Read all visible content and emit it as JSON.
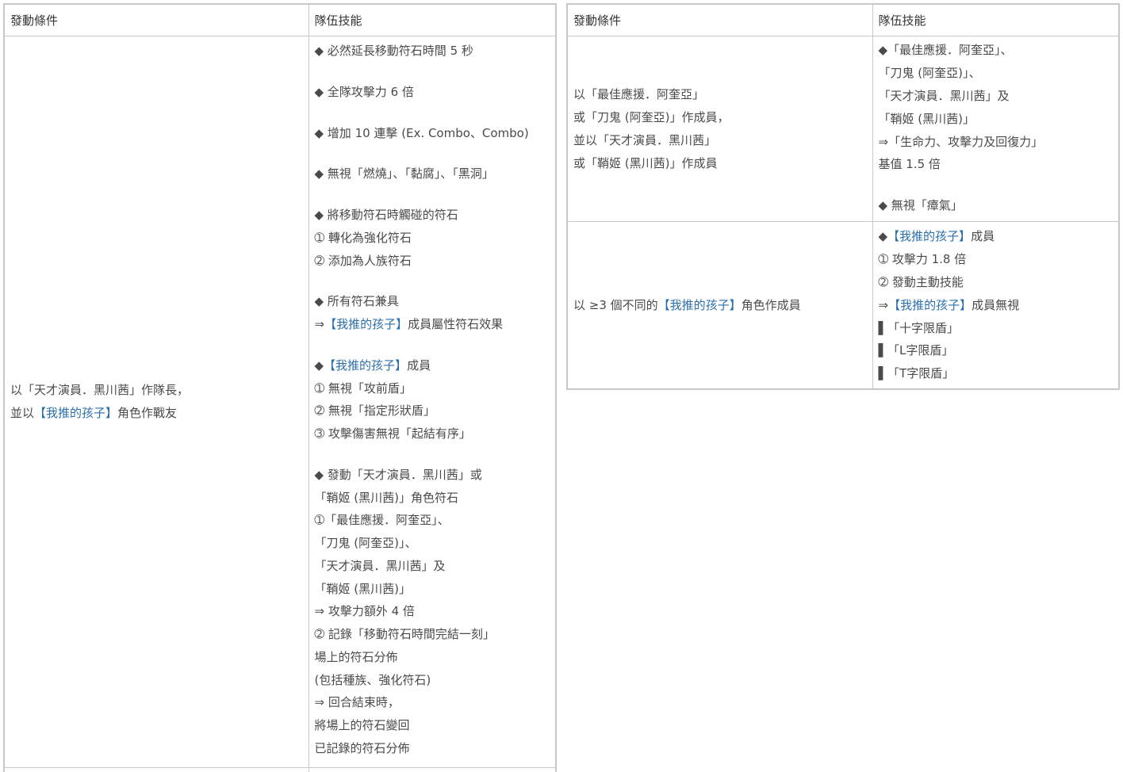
{
  "left_table": {
    "header": {
      "condition": "發動條件",
      "skill": "隊伍技能"
    },
    "row": {
      "condition_lines": [
        {
          "segments": [
            {
              "text": "以「天才演員．黑川茜」作隊長，",
              "link": false
            }
          ]
        },
        {
          "segments": [
            {
              "text": "並以",
              "link": false
            },
            {
              "text": "【我推的孩子】",
              "link": true
            },
            {
              "text": "角色作戰友",
              "link": false
            }
          ]
        }
      ],
      "skill_lines": [
        {
          "segments": [
            {
              "text": "◆ 必然延長移動符石時間 5 秒",
              "link": false
            }
          ]
        },
        {
          "blank": true
        },
        {
          "segments": [
            {
              "text": "◆ 全隊攻擊力 6 倍",
              "link": false
            }
          ]
        },
        {
          "blank": true
        },
        {
          "segments": [
            {
              "text": "◆ 增加 10 連擊 (Ex. Combo、Combo)",
              "link": false
            }
          ]
        },
        {
          "blank": true
        },
        {
          "segments": [
            {
              "text": "◆ 無視「燃燒」、「黏腐」、「黑洞」",
              "link": false
            }
          ]
        },
        {
          "blank": true
        },
        {
          "segments": [
            {
              "text": "◆ 將移動符石時觸碰的符石",
              "link": false
            }
          ]
        },
        {
          "segments": [
            {
              "text": "➀ 轉化為強化符石",
              "link": false
            }
          ]
        },
        {
          "segments": [
            {
              "text": "➁ 添加為人族符石",
              "link": false
            }
          ]
        },
        {
          "blank": true
        },
        {
          "segments": [
            {
              "text": "◆ 所有符石兼具",
              "link": false
            }
          ]
        },
        {
          "segments": [
            {
              "text": "⇒",
              "link": false
            },
            {
              "text": "【我推的孩子】",
              "link": true
            },
            {
              "text": "成員屬性符石效果",
              "link": false
            }
          ]
        },
        {
          "blank": true
        },
        {
          "segments": [
            {
              "text": "◆",
              "link": false
            },
            {
              "text": "【我推的孩子】",
              "link": true
            },
            {
              "text": "成員",
              "link": false
            }
          ]
        },
        {
          "segments": [
            {
              "text": "➀ 無視「攻前盾」",
              "link": false
            }
          ]
        },
        {
          "segments": [
            {
              "text": "➁ 無視「指定形狀盾」",
              "link": false
            }
          ]
        },
        {
          "segments": [
            {
              "text": "➂ 攻擊傷害無視「起結有序」",
              "link": false
            }
          ]
        },
        {
          "blank": true
        },
        {
          "segments": [
            {
              "text": "◆ 發動「天才演員．黑川茜」或",
              "link": false
            }
          ]
        },
        {
          "segments": [
            {
              "text": "「鞘姬 (黑川茜)」角色符石",
              "link": false
            }
          ]
        },
        {
          "segments": [
            {
              "text": "➀「最佳應援．阿奎亞」、",
              "link": false
            }
          ]
        },
        {
          "segments": [
            {
              "text": "「刀鬼 (阿奎亞)」、",
              "link": false
            }
          ]
        },
        {
          "segments": [
            {
              "text": "「天才演員．黑川茜」及",
              "link": false
            }
          ]
        },
        {
          "segments": [
            {
              "text": "「鞘姬 (黑川茜)」",
              "link": false
            }
          ]
        },
        {
          "segments": [
            {
              "text": "⇒ 攻擊力額外 4 倍",
              "link": false
            }
          ]
        },
        {
          "segments": [
            {
              "text": "➁ 記錄「移動符石時間完結一刻」",
              "link": false
            }
          ]
        },
        {
          "segments": [
            {
              "text": "場上的符石分佈",
              "link": false
            }
          ]
        },
        {
          "segments": [
            {
              "text": "(包括種族、強化符石)",
              "link": false
            }
          ]
        },
        {
          "segments": [
            {
              "text": "⇒ 回合結束時，",
              "link": false
            }
          ]
        },
        {
          "segments": [
            {
              "text": "將場上的符石變回",
              "link": false
            }
          ]
        },
        {
          "segments": [
            {
              "text": "已記錄的符石分佈",
              "link": false
            }
          ]
        }
      ]
    }
  },
  "right_table": {
    "header": {
      "condition": "發動條件",
      "skill": "隊伍技能"
    },
    "rows": [
      {
        "condition_lines": [
          {
            "segments": [
              {
                "text": "以「最佳應援．阿奎亞」",
                "link": false
              }
            ]
          },
          {
            "segments": [
              {
                "text": "或「刀鬼 (阿奎亞)」作成員，",
                "link": false
              }
            ]
          },
          {
            "segments": [
              {
                "text": "並以「天才演員．黑川茜」",
                "link": false
              }
            ]
          },
          {
            "segments": [
              {
                "text": "或「鞘姬 (黑川茜)」作成員",
                "link": false
              }
            ]
          }
        ],
        "skill_lines": [
          {
            "segments": [
              {
                "text": "◆「最佳應援．阿奎亞」、",
                "link": false
              }
            ]
          },
          {
            "segments": [
              {
                "text": "「刀鬼 (阿奎亞)」、",
                "link": false
              }
            ]
          },
          {
            "segments": [
              {
                "text": "「天才演員．黑川茜」及",
                "link": false
              }
            ]
          },
          {
            "segments": [
              {
                "text": "「鞘姬 (黑川茜)」",
                "link": false
              }
            ]
          },
          {
            "segments": [
              {
                "text": "⇒「生命力、攻擊力及回復力」",
                "link": false
              }
            ]
          },
          {
            "segments": [
              {
                "text": "基值 1.5 倍",
                "link": false
              }
            ]
          },
          {
            "blank": true
          },
          {
            "segments": [
              {
                "text": "◆ 無視「瘴氣」",
                "link": false
              }
            ]
          }
        ]
      },
      {
        "condition_lines": [
          {
            "segments": [
              {
                "text": "以 ≥3 個不同的",
                "link": false
              },
              {
                "text": "【我推的孩子】",
                "link": true
              },
              {
                "text": "角色作成員",
                "link": false
              }
            ]
          }
        ],
        "skill_lines": [
          {
            "segments": [
              {
                "text": "◆",
                "link": false
              },
              {
                "text": "【我推的孩子】",
                "link": true
              },
              {
                "text": "成員",
                "link": false
              }
            ]
          },
          {
            "segments": [
              {
                "text": "➀ 攻擊力 1.8 倍",
                "link": false
              }
            ]
          },
          {
            "segments": [
              {
                "text": "➁ 發動主動技能",
                "link": false
              }
            ]
          },
          {
            "segments": [
              {
                "text": "⇒",
                "link": false
              },
              {
                "text": "【我推的孩子】",
                "link": true
              },
              {
                "text": "成員無視",
                "link": false
              }
            ]
          },
          {
            "segments": [
              {
                "text": "▌「十字限盾」",
                "link": false
              }
            ]
          },
          {
            "segments": [
              {
                "text": "▌「L字限盾」",
                "link": false
              }
            ]
          },
          {
            "segments": [
              {
                "text": "▌「T字限盾」",
                "link": false
              }
            ]
          }
        ]
      }
    ]
  },
  "colors": {
    "text": "#4a4a4a",
    "link": "#2a6fad",
    "border": "#c8c8c8"
  }
}
